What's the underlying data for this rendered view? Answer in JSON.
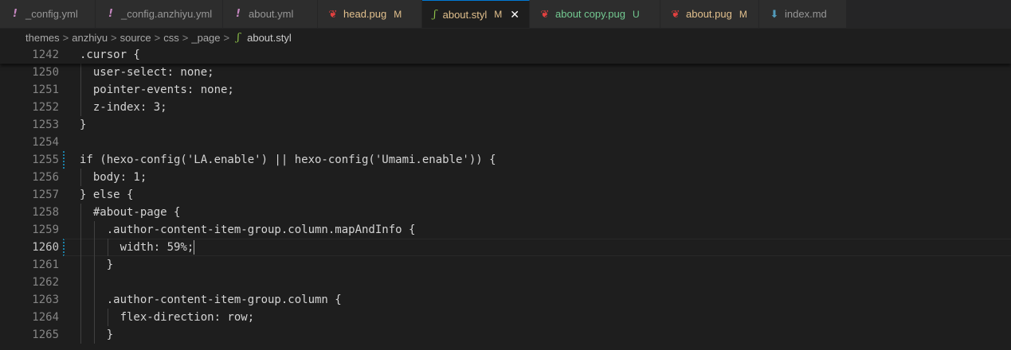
{
  "tabs": [
    {
      "label": "_config.yml",
      "icon": "!",
      "icon_name": "yaml-icon",
      "status": ""
    },
    {
      "label": "_config.anzhiyu.yml",
      "icon": "!",
      "icon_name": "yaml-icon",
      "status": ""
    },
    {
      "label": "about.yml",
      "icon": "!",
      "icon_name": "yaml-icon",
      "status": ""
    },
    {
      "label": "head.pug",
      "icon": "❦",
      "icon_name": "pug-icon",
      "status": "M"
    },
    {
      "label": "about.styl",
      "icon": "ʃ",
      "icon_name": "stylus-icon",
      "status": "M",
      "close": "✕"
    },
    {
      "label": "about copy.pug",
      "icon": "❦",
      "icon_name": "pug-icon",
      "status": "U"
    },
    {
      "label": "about.pug",
      "icon": "❦",
      "icon_name": "pug-icon",
      "status": "M"
    },
    {
      "label": "index.md",
      "icon": "⬇",
      "icon_name": "markdown-icon",
      "status": ""
    }
  ],
  "breadcrumb": {
    "parts": [
      "themes",
      "anzhiyu",
      "source",
      "css",
      "_page"
    ],
    "separator": ">",
    "file_icon": "ʃ",
    "file": "about.styl"
  },
  "sticky": {
    "num": "1242",
    "text": ".cursor {"
  },
  "lines": [
    {
      "num": "1250",
      "text": "  user-select: none;"
    },
    {
      "num": "1251",
      "text": "  pointer-events: none;"
    },
    {
      "num": "1252",
      "text": "  z-index: 3;"
    },
    {
      "num": "1253",
      "text": "}"
    },
    {
      "num": "1254",
      "text": ""
    },
    {
      "num": "1255",
      "text": "if (hexo-config('LA.enable') || hexo-config('Umami.enable')) {"
    },
    {
      "num": "1256",
      "text": "  body: 1;"
    },
    {
      "num": "1257",
      "text": "} else {"
    },
    {
      "num": "1258",
      "text": "  #about-page {"
    },
    {
      "num": "1259",
      "text": "    .author-content-item-group.column.mapAndInfo {"
    },
    {
      "num": "1260",
      "text": "      width: 59%;"
    },
    {
      "num": "1261",
      "text": "    }"
    },
    {
      "num": "1262",
      "text": ""
    },
    {
      "num": "1263",
      "text": "    .author-content-item-group.column {"
    },
    {
      "num": "1264",
      "text": "      flex-direction: row;"
    },
    {
      "num": "1265",
      "text": "    }"
    }
  ],
  "colors": {
    "modified": "#e2c08d",
    "untracked": "#73c991",
    "active_border": "#0078d4"
  }
}
